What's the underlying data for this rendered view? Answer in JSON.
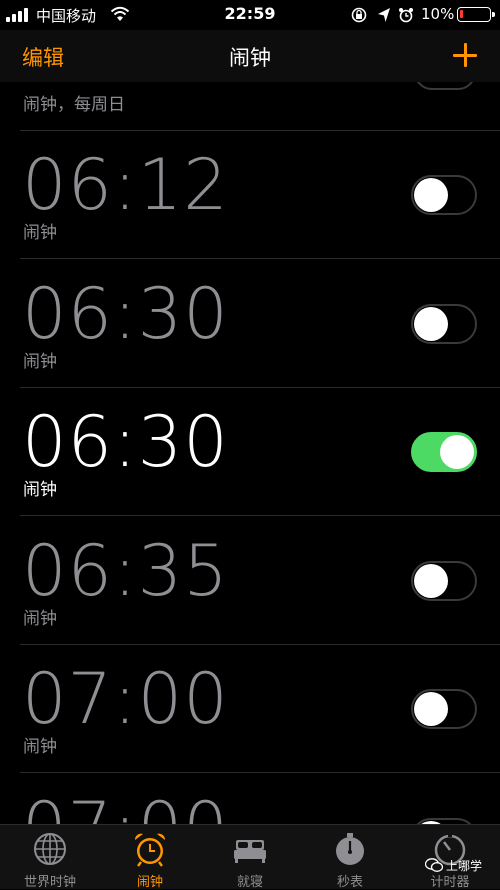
{
  "status_bar": {
    "carrier": "中国移动",
    "time": "22:59",
    "battery_percent": "10%",
    "battery_level": 0.1,
    "battery_color": "#ff3b30"
  },
  "nav": {
    "edit_label": "编辑",
    "title": "闹钟",
    "add_icon": "plus-icon"
  },
  "alarms_partial_top": {
    "label": "闹钟，每周日"
  },
  "alarms": [
    {
      "time": "06:12",
      "label": "闹钟",
      "enabled": false
    },
    {
      "time": "06:30",
      "label": "闹钟",
      "enabled": false
    },
    {
      "time": "06:30",
      "label": "闹钟",
      "enabled": true
    },
    {
      "time": "06:35",
      "label": "闹钟",
      "enabled": false
    },
    {
      "time": "07:00",
      "label": "闹钟",
      "enabled": false
    },
    {
      "time": "07:00",
      "label": "",
      "enabled": false
    }
  ],
  "tabs": [
    {
      "label": "世界时钟",
      "icon": "globe-icon",
      "active": false
    },
    {
      "label": "闹钟",
      "icon": "alarm-clock-icon",
      "active": true
    },
    {
      "label": "就寝",
      "icon": "bed-icon",
      "active": false
    },
    {
      "label": "秒表",
      "icon": "stopwatch-icon",
      "active": false
    },
    {
      "label": "计时器",
      "icon": "timer-icon",
      "active": false
    }
  ],
  "watermark": {
    "text": "上哪学"
  },
  "colors": {
    "accent": "#ff9500",
    "toggle_on": "#4cd964"
  }
}
